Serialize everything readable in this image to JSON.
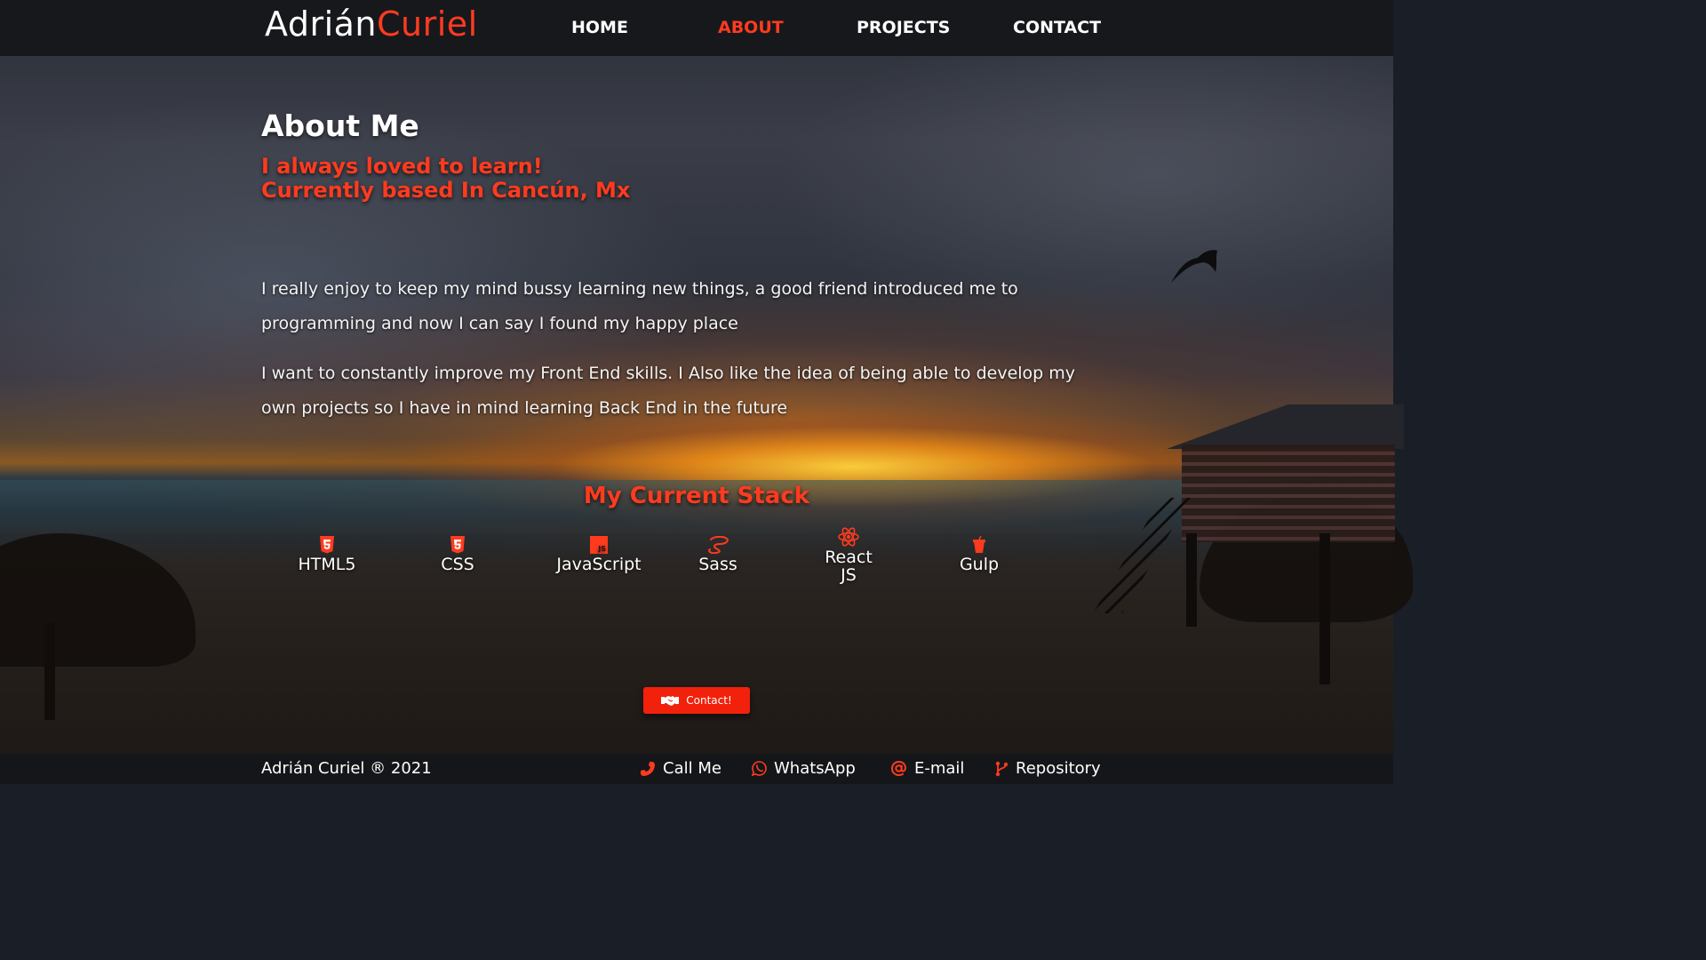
{
  "brand": {
    "first_name": "Adrián",
    "last_name": "Curiel"
  },
  "nav": {
    "items": [
      {
        "label": "HOME",
        "active": false
      },
      {
        "label": "ABOUT",
        "active": true
      },
      {
        "label": "PROJECTS",
        "active": false
      },
      {
        "label": "CONTACT",
        "active": false
      }
    ]
  },
  "about": {
    "title": "About Me",
    "tagline_1": "I always loved to learn!",
    "tagline_2": "Currently based In Cancún, Mx",
    "paragraph_1": "I really enjoy to keep my mind bussy learning new things, a good friend introduced me to programming and now I can say I found my happy place",
    "paragraph_2": "I want to constantly improve my Front End skills. I Also like the idea of being able to develop my own projects so I have in mind learning Back End in the future"
  },
  "stack": {
    "title": "My Current Stack",
    "items": [
      {
        "label": "HTML5",
        "icon": "html5-icon"
      },
      {
        "label": "CSS",
        "icon": "css3-icon"
      },
      {
        "label": "JavaScript",
        "icon": "javascript-icon"
      },
      {
        "label": "Sass",
        "icon": "sass-icon"
      },
      {
        "label_1": "React",
        "label_2": "JS",
        "icon": "react-icon"
      },
      {
        "label": "Gulp",
        "icon": "gulp-icon"
      }
    ]
  },
  "contact_button": {
    "label": "Contact!",
    "icon": "handshake-icon"
  },
  "footer": {
    "copyright": "Adrián Curiel  ® 2021",
    "links": [
      {
        "label": "Call Me",
        "icon": "phone-icon"
      },
      {
        "label": "WhatsApp",
        "icon": "whatsapp-icon"
      },
      {
        "label": "E-mail",
        "icon": "at-sign-icon"
      },
      {
        "label": "Repository",
        "icon": "git-branch-icon"
      }
    ]
  },
  "colors": {
    "accent": "#ff3b1f",
    "header_bg": "#17181c",
    "footer_bg": "#15161a",
    "button_bg": "#f2210b"
  }
}
